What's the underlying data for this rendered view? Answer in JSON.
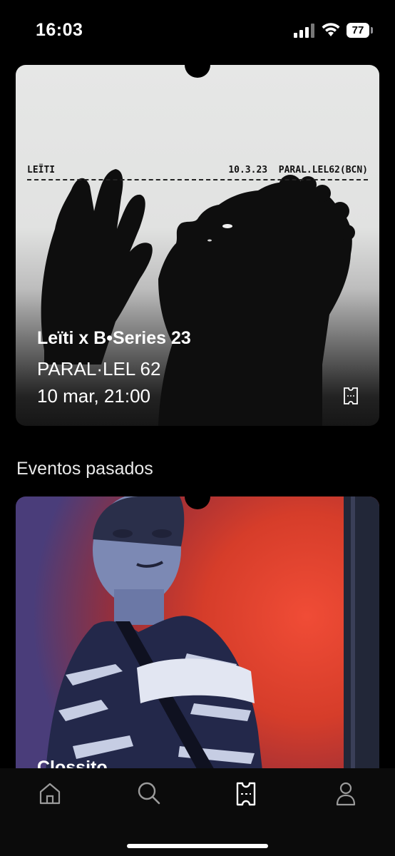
{
  "status_bar": {
    "time": "16:03",
    "battery": "77"
  },
  "upcoming_event": {
    "poster_artist": "LEÏTI",
    "poster_meta": "10.3.23  PARAL.LEL62(BCN)",
    "title": "Leïti x B•Series 23",
    "venue": "PARAL·LEL 62",
    "datetime": "10 mar, 21:00"
  },
  "past_section": {
    "heading": "Eventos pasados",
    "event_title": "Clossito"
  },
  "tabs": [
    {
      "name": "home",
      "icon": "home-icon"
    },
    {
      "name": "search",
      "icon": "search-icon"
    },
    {
      "name": "tickets",
      "icon": "ticket-icon",
      "active": true
    },
    {
      "name": "profile",
      "icon": "profile-icon"
    }
  ]
}
